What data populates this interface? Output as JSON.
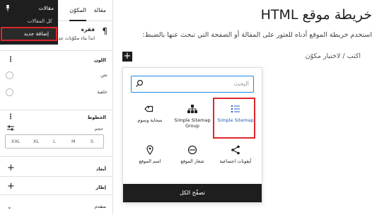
{
  "canvas": {
    "title": "خريطة موقع HTML",
    "intro": "استخدم خريطة الموقع أدناه للعثور على المقالة أو الصفحة التي تبحث عنها بالضبط:",
    "placeholder": "اكتب / لاختيار مكوّن",
    "add_block_label": "+"
  },
  "inserter": {
    "search_placeholder": "البحث",
    "blocks": [
      {
        "label": "سحابة وسوم",
        "icon": "tag-icon"
      },
      {
        "label": "Simple Sitemap Group",
        "icon": "hierarchy-icon"
      },
      {
        "label": "Simple Sitemap",
        "icon": "list-icon",
        "selected": true
      },
      {
        "label": "اسم الموقع",
        "icon": "map-pin-icon"
      },
      {
        "label": "شعار الموقع",
        "icon": "site-logo-icon"
      },
      {
        "label": "أيقونات اجتماعية",
        "icon": "share-icon"
      }
    ],
    "browse_all": "تصفّح الكل"
  },
  "sidebar": {
    "tabs": {
      "article": "مقالة",
      "block": "المكوّن"
    },
    "dropdown": {
      "header": "مقالات",
      "all_articles": "كل المقالات",
      "add_new": "إضافة جديد"
    },
    "block_card": {
      "title": "فقرة",
      "description": "ابدأ بناء مكوّنات جديدة"
    },
    "color": {
      "title": "اللون",
      "options": [
        "نص",
        "خلفية"
      ]
    },
    "typography": {
      "title": "الخطوط",
      "size_label": "حجم",
      "sizes": [
        "XXL",
        "XL",
        "L",
        "M",
        "S"
      ]
    },
    "dimensions_title": "أبعاد",
    "border_title": "إطار",
    "advanced_title": "متقدم"
  }
}
